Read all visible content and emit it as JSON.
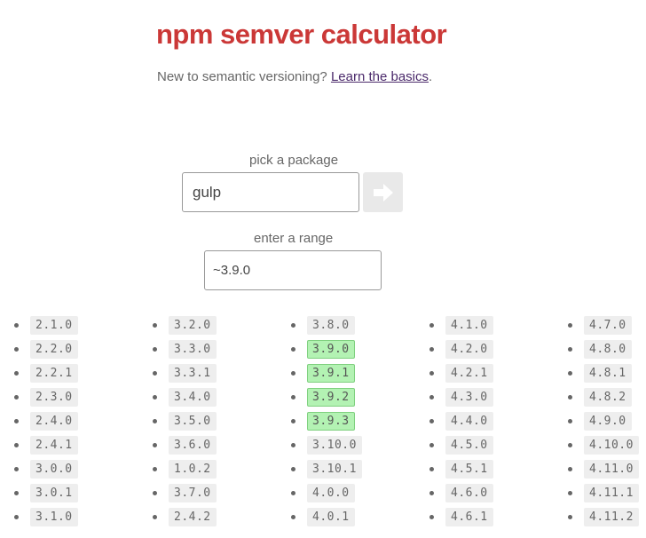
{
  "header": {
    "title": "npm semver calculator",
    "intro_text": "New to semantic versioning? ",
    "intro_link": "Learn the basics",
    "intro_end": "."
  },
  "package": {
    "label": "pick a package",
    "value": "gulp"
  },
  "range": {
    "label": "enter a range",
    "value": "~3.9.0"
  },
  "colors": {
    "title": "#cb3837",
    "match_bg": "#b3f2b3",
    "version_bg": "#eeeeee"
  },
  "icons": {
    "go_button": "arrow-right-icon"
  },
  "versions": {
    "columns": [
      [
        {
          "v": "2.1.0",
          "match": false
        },
        {
          "v": "2.2.0",
          "match": false
        },
        {
          "v": "2.2.1",
          "match": false
        },
        {
          "v": "2.3.0",
          "match": false
        },
        {
          "v": "2.4.0",
          "match": false
        },
        {
          "v": "2.4.1",
          "match": false
        },
        {
          "v": "3.0.0",
          "match": false
        },
        {
          "v": "3.0.1",
          "match": false
        },
        {
          "v": "3.1.0",
          "match": false
        }
      ],
      [
        {
          "v": "3.2.0",
          "match": false
        },
        {
          "v": "3.3.0",
          "match": false
        },
        {
          "v": "3.3.1",
          "match": false
        },
        {
          "v": "3.4.0",
          "match": false
        },
        {
          "v": "3.5.0",
          "match": false
        },
        {
          "v": "3.6.0",
          "match": false
        },
        {
          "v": "1.0.2",
          "match": false
        },
        {
          "v": "3.7.0",
          "match": false
        },
        {
          "v": "2.4.2",
          "match": false
        }
      ],
      [
        {
          "v": "3.8.0",
          "match": false
        },
        {
          "v": "3.9.0",
          "match": true
        },
        {
          "v": "3.9.1",
          "match": true
        },
        {
          "v": "3.9.2",
          "match": true
        },
        {
          "v": "3.9.3",
          "match": true
        },
        {
          "v": "3.10.0",
          "match": false
        },
        {
          "v": "3.10.1",
          "match": false
        },
        {
          "v": "4.0.0",
          "match": false
        },
        {
          "v": "4.0.1",
          "match": false
        }
      ],
      [
        {
          "v": "4.1.0",
          "match": false
        },
        {
          "v": "4.2.0",
          "match": false
        },
        {
          "v": "4.2.1",
          "match": false
        },
        {
          "v": "4.3.0",
          "match": false
        },
        {
          "v": "4.4.0",
          "match": false
        },
        {
          "v": "4.5.0",
          "match": false
        },
        {
          "v": "4.5.1",
          "match": false
        },
        {
          "v": "4.6.0",
          "match": false
        },
        {
          "v": "4.6.1",
          "match": false
        }
      ],
      [
        {
          "v": "4.7.0",
          "match": false
        },
        {
          "v": "4.8.0",
          "match": false
        },
        {
          "v": "4.8.1",
          "match": false
        },
        {
          "v": "4.8.2",
          "match": false
        },
        {
          "v": "4.9.0",
          "match": false
        },
        {
          "v": "4.10.0",
          "match": false
        },
        {
          "v": "4.11.0",
          "match": false
        },
        {
          "v": "4.11.1",
          "match": false
        },
        {
          "v": "4.11.2",
          "match": false
        }
      ]
    ]
  }
}
